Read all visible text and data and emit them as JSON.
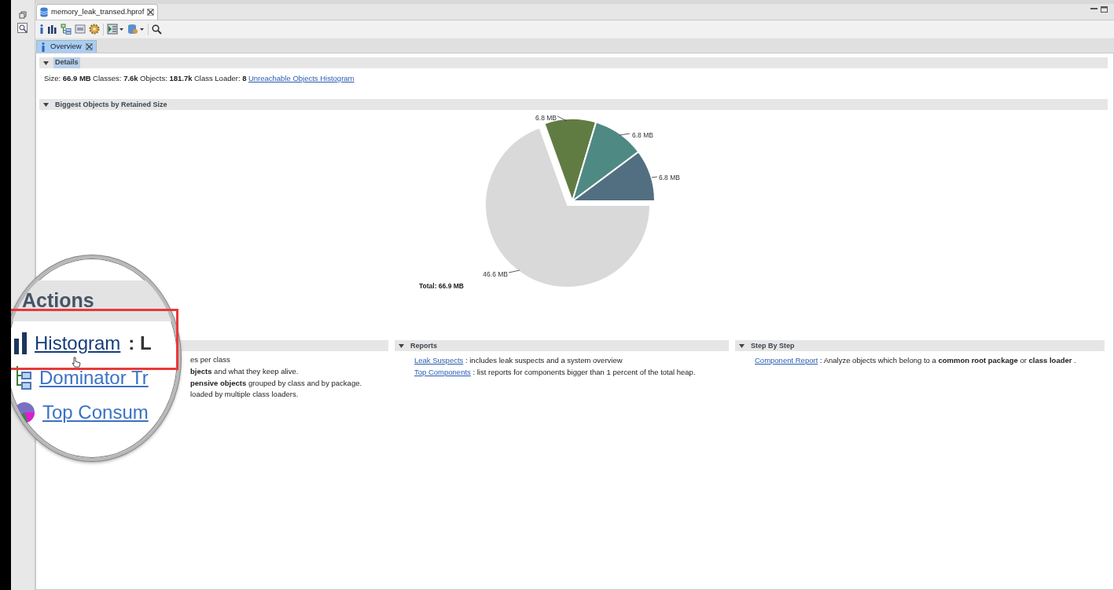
{
  "editor_tab": {
    "label": "memory_leak_transed.hprof",
    "selected": true
  },
  "overview_tab": {
    "label": "Overview",
    "selected": true
  },
  "details": {
    "title": "Details",
    "title_selected": true,
    "stats": [
      {
        "label": "Size:",
        "value": "66.9 MB"
      },
      {
        "label": "Classes:",
        "value": "7.6k"
      },
      {
        "label": "Objects:",
        "value": "181.7k"
      },
      {
        "label": "Class Loader:",
        "value": "8"
      }
    ],
    "link": "Unreachable Objects Histogram"
  },
  "biggest_objects": {
    "title": "Biggest Objects by Retained Size",
    "chart_data": {
      "type": "pie",
      "values": [
        6.8,
        6.8,
        6.8,
        46.6
      ],
      "value_labels": [
        "6.8 MB",
        "6.8 MB",
        "6.8 MB",
        "46.6 MB"
      ],
      "annotations": [
        "Total: 66.9 MB"
      ]
    }
  },
  "actions": {
    "lines": [
      "es per class",
      "**bjects** and what they keep alive.",
      "**pensive objects** grouped by class and by package.",
      "loaded by multiple class loaders."
    ]
  },
  "magnifier": {
    "title": "Actions",
    "items": [
      {
        "kind": "histogram",
        "link": "Histogram",
        "text": ": L",
        "highlighted": true
      },
      {
        "kind": "tree",
        "link": "Dominator Tr",
        "highlighted": false
      },
      {
        "kind": "pie",
        "link": "Top Consum",
        "highlighted": false
      }
    ]
  },
  "reports": {
    "title": "Reports",
    "items": [
      {
        "link": "Leak Suspects",
        "text": ": includes leak suspects and a system overview"
      },
      {
        "link": "Top Components",
        "text": ": list reports for components bigger than 1 percent of the total heap."
      }
    ]
  },
  "step_by_step": {
    "title": "Step By Step",
    "items": [
      {
        "link": "Component Report",
        "text": ": Analyze objects which belong to a **common root package** or **class loader** ."
      }
    ]
  }
}
